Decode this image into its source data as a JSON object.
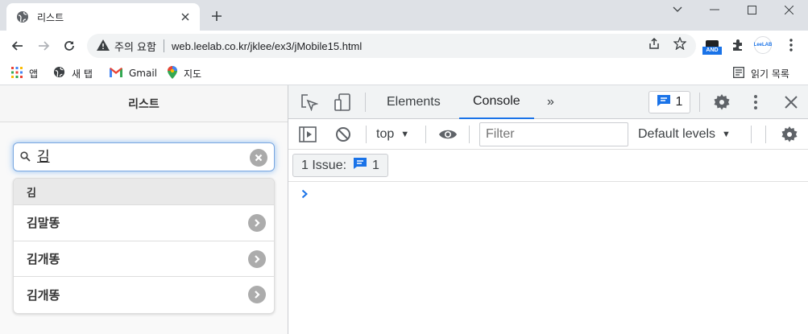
{
  "window": {
    "tab_title": "리스트",
    "new_tab_label": "+",
    "controls": [
      "minimize",
      "maximize",
      "close"
    ]
  },
  "toolbar": {
    "security_label": "주의 요함",
    "url": "web.leelab.co.kr/jklee/ex3/jMobile15.html",
    "ext_badge_label": "AND",
    "profile_label": "LeeLAB"
  },
  "bookmarks": {
    "items": [
      {
        "icon": "apps-grid-icon",
        "label": "앱"
      },
      {
        "icon": "globe-icon",
        "label": "새 탭"
      },
      {
        "icon": "gmail-icon",
        "label": "Gmail"
      },
      {
        "icon": "maps-pin-icon",
        "label": "지도"
      }
    ],
    "reading_list_label": "읽기 목록"
  },
  "page": {
    "header_title": "리스트",
    "search_value": "김",
    "divider_label": "김",
    "items": [
      "김말똥",
      "김개똥",
      "김개똥"
    ]
  },
  "devtools": {
    "tabs": [
      "Elements",
      "Console"
    ],
    "active_tab": "Console",
    "more_tabs_glyph": "»",
    "issues_count": "1",
    "context": "top",
    "filter_placeholder": "Filter",
    "levels_label": "Default levels",
    "issue_chip_label": "1 Issue:",
    "issue_chip_count": "1",
    "prompt_glyph": ">"
  },
  "colors": {
    "accent": "#1a73e8",
    "tabstrip": "#dee1e6",
    "focus_glow": "#388ce9"
  }
}
